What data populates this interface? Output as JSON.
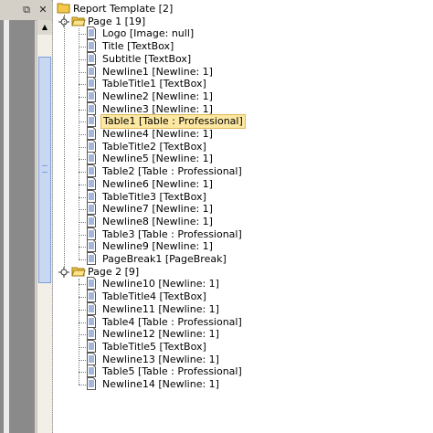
{
  "window": {
    "restore_glyph": "⧉",
    "close_glyph": "✕"
  },
  "tree": {
    "root": {
      "label": "Report Template [2]",
      "icon": "folder-icon"
    },
    "pages": [
      {
        "label": "Page 1 [19]",
        "icon": "folder-open-icon",
        "items": [
          {
            "label": "Logo [Image: null]"
          },
          {
            "label": "Title [TextBox]"
          },
          {
            "label": "Subtitle [TextBox]"
          },
          {
            "label": "Newline1 [Newline: 1]"
          },
          {
            "label": "TableTitle1 [TextBox]"
          },
          {
            "label": "Newline2 [Newline: 1]"
          },
          {
            "label": "Newline3 [Newline: 1]"
          },
          {
            "label": "Table1 [Table : Professional]",
            "selected": true
          },
          {
            "label": "Newline4 [Newline: 1]"
          },
          {
            "label": "TableTitle2 [TextBox]"
          },
          {
            "label": "Newline5 [Newline: 1]"
          },
          {
            "label": "Table2 [Table : Professional]"
          },
          {
            "label": "Newline6 [Newline: 1]"
          },
          {
            "label": "TableTitle3 [TextBox]"
          },
          {
            "label": "Newline7 [Newline: 1]"
          },
          {
            "label": "Newline8 [Newline: 1]"
          },
          {
            "label": "Table3 [Table : Professional]"
          },
          {
            "label": "Newline9 [Newline: 1]"
          },
          {
            "label": "PageBreak1 [PageBreak]"
          }
        ]
      },
      {
        "label": "Page 2 [9]",
        "icon": "folder-open-icon",
        "items": [
          {
            "label": "Newline10 [Newline: 1]"
          },
          {
            "label": "TableTitle4 [TextBox]"
          },
          {
            "label": "Newline11 [Newline: 1]"
          },
          {
            "label": "Table4 [Table : Professional]"
          },
          {
            "label": "Newline12 [Newline: 1]"
          },
          {
            "label": "TableTitle5 [TextBox]"
          },
          {
            "label": "Newline13 [Newline: 1]"
          },
          {
            "label": "Table5 [Table : Professional]"
          },
          {
            "label": "Newline14 [Newline: 1]"
          }
        ]
      }
    ]
  },
  "colors": {
    "selection_bg": "#fde8a3",
    "folder": "#f5c84a",
    "doc_lines": "#4a6fb5"
  }
}
